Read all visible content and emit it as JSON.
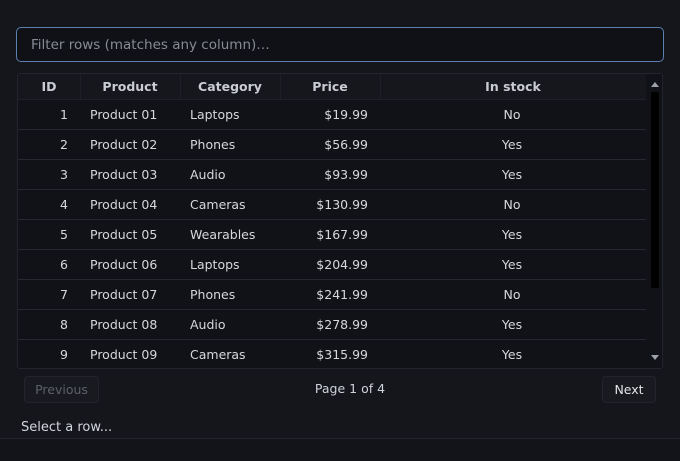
{
  "filter": {
    "placeholder": "Filter rows (matches any column)…",
    "value": ""
  },
  "table": {
    "columns": [
      "ID",
      "Product",
      "Category",
      "Price",
      "In stock"
    ],
    "rows": [
      {
        "id": "1",
        "product": "Product 01",
        "category": "Laptops",
        "price": "$19.99",
        "stock": "No"
      },
      {
        "id": "2",
        "product": "Product 02",
        "category": "Phones",
        "price": "$56.99",
        "stock": "Yes"
      },
      {
        "id": "3",
        "product": "Product 03",
        "category": "Audio",
        "price": "$93.99",
        "stock": "Yes"
      },
      {
        "id": "4",
        "product": "Product 04",
        "category": "Cameras",
        "price": "$130.99",
        "stock": "No"
      },
      {
        "id": "5",
        "product": "Product 05",
        "category": "Wearables",
        "price": "$167.99",
        "stock": "Yes"
      },
      {
        "id": "6",
        "product": "Product 06",
        "category": "Laptops",
        "price": "$204.99",
        "stock": "Yes"
      },
      {
        "id": "7",
        "product": "Product 07",
        "category": "Phones",
        "price": "$241.99",
        "stock": "No"
      },
      {
        "id": "8",
        "product": "Product 08",
        "category": "Audio",
        "price": "$278.99",
        "stock": "Yes"
      },
      {
        "id": "9",
        "product": "Product 09",
        "category": "Cameras",
        "price": "$315.99",
        "stock": "Yes"
      }
    ]
  },
  "pagination": {
    "previous_label": "Previous",
    "page_info": "Page 1 of 4",
    "next_label": "Next"
  },
  "status": {
    "text": "Select a row..."
  }
}
